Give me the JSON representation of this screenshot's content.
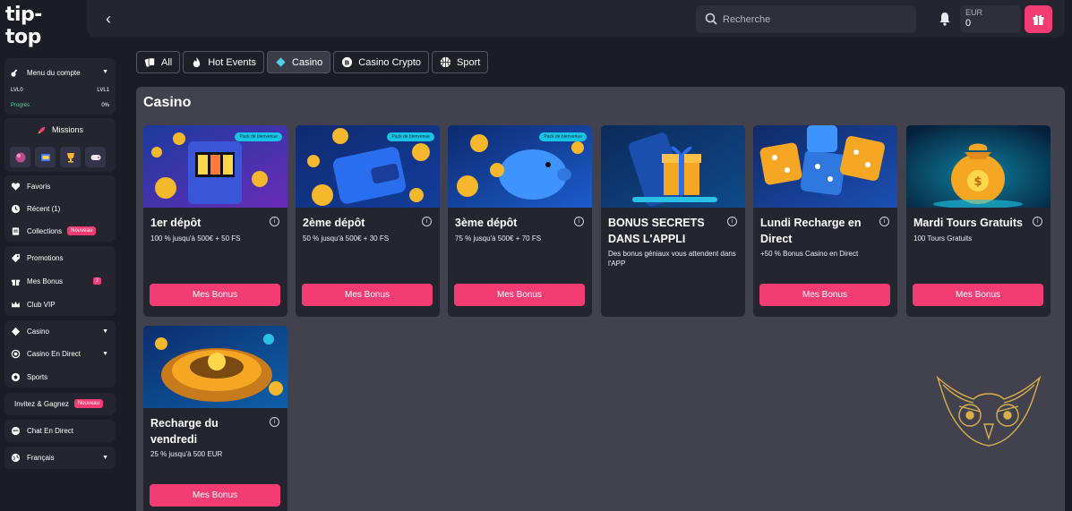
{
  "logo": {
    "text": "tip-top"
  },
  "topbar": {
    "search_placeholder": "Recherche",
    "currency": "EUR",
    "balance": "0"
  },
  "sidebar": {
    "account_menu": "Menu du compte",
    "level_left": "LVL0",
    "level_right": "LVL1",
    "progress_label": "Progrès",
    "progress_value": "0%",
    "missions_label": "Missions",
    "items": [
      {
        "label": "Favoris",
        "icon": "heart-icon"
      },
      {
        "label": "Récent (1)",
        "icon": "clock-icon"
      },
      {
        "label": "Collections",
        "icon": "collections-icon",
        "badge": "Nouveau"
      },
      {
        "label": "Promotions",
        "icon": "tag-icon"
      },
      {
        "label": "Mes Bonus",
        "icon": "gift-icon",
        "count": "3"
      },
      {
        "label": "Club VIP",
        "icon": "crown-icon"
      },
      {
        "label": "Casino",
        "icon": "diamond-icon"
      },
      {
        "label": "Casino En Direct",
        "icon": "live-icon"
      },
      {
        "label": "Sports",
        "icon": "ball-icon"
      }
    ],
    "invite_label": "Invitez & Gagnez",
    "invite_badge": "Nouveau",
    "chat_label": "Chat En Direct",
    "language_label": "Français"
  },
  "tabs": [
    {
      "label": "All",
      "icon": "cards-icon",
      "active": false
    },
    {
      "label": "Hot Events",
      "icon": "flame-icon",
      "active": false
    },
    {
      "label": "Casino",
      "icon": "diamond-icon",
      "active": true
    },
    {
      "label": "Casino Crypto",
      "icon": "bitcoin-icon",
      "active": false
    },
    {
      "label": "Sport",
      "icon": "ball-icon",
      "active": false
    }
  ],
  "panel": {
    "title": "Casino"
  },
  "cards": [
    {
      "title": "1er dépôt",
      "desc": "100 % jusqu'à 500€ + 50 FS",
      "button": "Mes Bonus",
      "welcome": "Pack de bienvenue"
    },
    {
      "title": "2ème dépôt",
      "desc": "50 % jusqu'à 500€ + 30 FS",
      "button": "Mes Bonus",
      "welcome": "Pack de bienvenue"
    },
    {
      "title": "3ème dépôt",
      "desc": "75 % jusqu'à 500€ + 70 FS",
      "button": "Mes Bonus",
      "welcome": "Pack de bienvenue"
    },
    {
      "title": "BONUS SECRETS DANS L'APPLI",
      "desc": "Des bonus géniaux vous attendent dans l'APP",
      "button": "",
      "welcome": ""
    },
    {
      "title": "Lundi Recharge en Direct",
      "desc": "+50 % Bonus Casino en Direct",
      "button": "Mes Bonus",
      "welcome": ""
    },
    {
      "title": "Mardi Tours Gratuits",
      "desc": "100 Tours Gratuits",
      "button": "Mes Bonus",
      "welcome": ""
    },
    {
      "title": "Recharge du vendredi",
      "desc": "25 % jusqu'à 500 EUR",
      "button": "Mes Bonus",
      "welcome": ""
    }
  ],
  "colors": {
    "accent": "#f33b74",
    "panel": "#42414e",
    "card": "#25252f",
    "welcome_badge": "#18c4e6"
  }
}
